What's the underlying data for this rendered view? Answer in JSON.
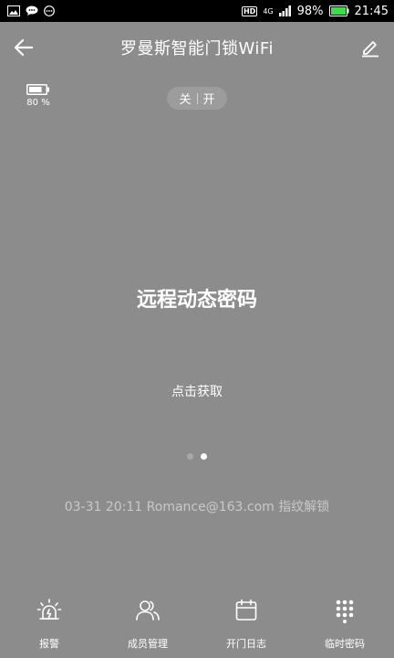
{
  "status_bar": {
    "network": "4G",
    "hd": "HD",
    "battery_percent": "98%",
    "time": "21:45"
  },
  "header": {
    "title": "罗曼斯智能门锁WiFi"
  },
  "battery": {
    "level": 0.8,
    "label": "80 %"
  },
  "toggle": {
    "off_label": "关",
    "on_label": "开"
  },
  "main": {
    "title": "远程动态密码",
    "action_label": "点击获取",
    "page_count": 2,
    "active_page": 2
  },
  "log": {
    "text": "03-31 20:11  Romance@163.com 指纹解锁"
  },
  "nav": {
    "items": [
      {
        "label": "报警",
        "icon": "alarm-icon"
      },
      {
        "label": "成员管理",
        "icon": "members-icon"
      },
      {
        "label": "开门日志",
        "icon": "calendar-icon"
      },
      {
        "label": "临时密码",
        "icon": "keypad-icon"
      }
    ]
  }
}
